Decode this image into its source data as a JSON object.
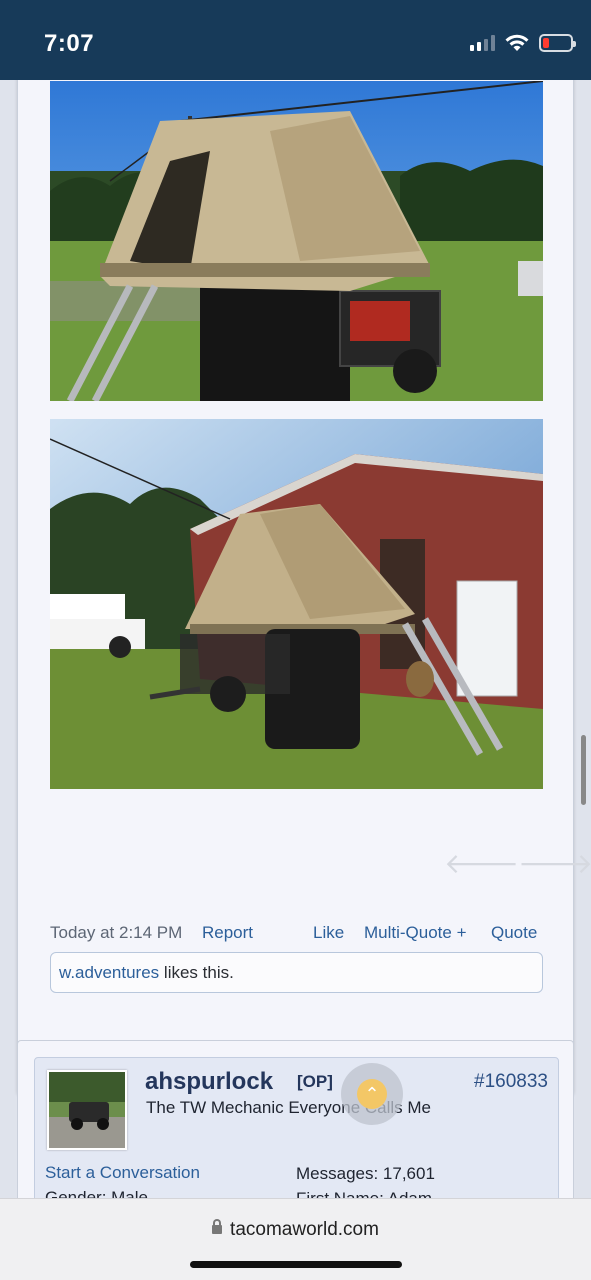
{
  "status_bar": {
    "time": "7:07",
    "icons": [
      "cellular-signal-icon",
      "wifi-icon",
      "battery-low-icon"
    ],
    "battery_color": "#ff3b30"
  },
  "post": {
    "photos": [
      {
        "name": "tent-trailer-photo-1"
      },
      {
        "name": "tent-trailer-photo-2"
      }
    ],
    "nav": {
      "prev_glyph": "🡐",
      "next_glyph": "🡒"
    },
    "meta": {
      "date": "Today at 2:14 PM",
      "report": "Report",
      "like": "Like",
      "multi_quote": "Multi-Quote +",
      "quote": "Quote"
    },
    "likes": {
      "user": "w.adventures",
      "suffix": " likes this."
    }
  },
  "user_card": {
    "username": "ahspurlock",
    "op_tag": "[OP]",
    "post_number": "#160833",
    "title": "The TW Mechanic Everyone Calls Me",
    "start_conversation": "Start a Conversation",
    "gender": "Gender:  Male",
    "messages": "Messages:  17,601",
    "first_name": "First Name:  Adam"
  },
  "url_bar": {
    "domain": "tacomaworld.com"
  },
  "colors": {
    "header": "#173a59",
    "link": "#2c5f9a",
    "username": "#24365c"
  }
}
